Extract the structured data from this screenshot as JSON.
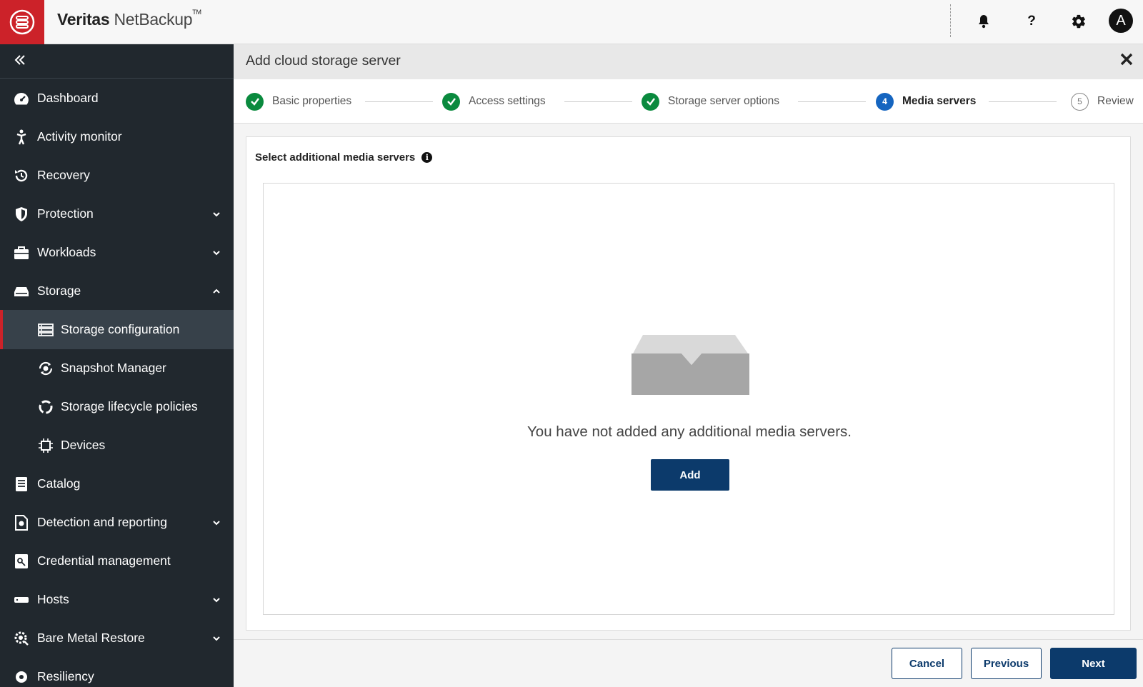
{
  "header": {
    "brand_bold": "Veritas",
    "brand_light": "NetBackup",
    "brand_tm": "TM",
    "help_glyph": "?",
    "avatar_initial": "A"
  },
  "sidebar": {
    "items": [
      {
        "label": "Dashboard",
        "icon": "dashboard-icon"
      },
      {
        "label": "Activity monitor",
        "icon": "activity-icon"
      },
      {
        "label": "Recovery",
        "icon": "recovery-icon"
      },
      {
        "label": "Protection",
        "icon": "shield-icon",
        "expandable": true
      },
      {
        "label": "Workloads",
        "icon": "briefcase-icon",
        "expandable": true
      },
      {
        "label": "Storage",
        "icon": "storage-icon",
        "expanded": true
      },
      {
        "label": "Storage configuration",
        "icon": "storage-config-icon",
        "sub": true,
        "active": true
      },
      {
        "label": "Snapshot Manager",
        "icon": "snapshot-icon",
        "sub": true
      },
      {
        "label": "Storage lifecycle policies",
        "icon": "lifecycle-icon",
        "sub": true
      },
      {
        "label": "Devices",
        "icon": "chip-icon",
        "sub": true
      },
      {
        "label": "Catalog",
        "icon": "catalog-icon"
      },
      {
        "label": "Detection and reporting",
        "icon": "report-icon",
        "expandable": true
      },
      {
        "label": "Credential management",
        "icon": "key-icon"
      },
      {
        "label": "Hosts",
        "icon": "host-icon",
        "expandable": true
      },
      {
        "label": "Bare Metal Restore",
        "icon": "gear-search-icon",
        "expandable": true
      },
      {
        "label": "Resiliency",
        "icon": "resiliency-icon"
      }
    ]
  },
  "dialog": {
    "title": "Add cloud storage server",
    "steps": [
      {
        "label": "Basic properties",
        "state": "done"
      },
      {
        "label": "Access settings",
        "state": "done"
      },
      {
        "label": "Storage server options",
        "state": "done"
      },
      {
        "label": "Media servers",
        "state": "current",
        "number": "4"
      },
      {
        "label": "Review",
        "state": "todo",
        "number": "5"
      }
    ],
    "section_label": "Select additional media servers",
    "empty_message": "You have not added any additional media servers.",
    "add_label": "Add",
    "cancel_label": "Cancel",
    "previous_label": "Previous",
    "next_label": "Next"
  },
  "colors": {
    "brand_red": "#cc2229",
    "sidebar_bg": "#21282e",
    "primary_button": "#0c3a6b",
    "step_done": "#0a8a3e",
    "step_current": "#1565c0"
  }
}
